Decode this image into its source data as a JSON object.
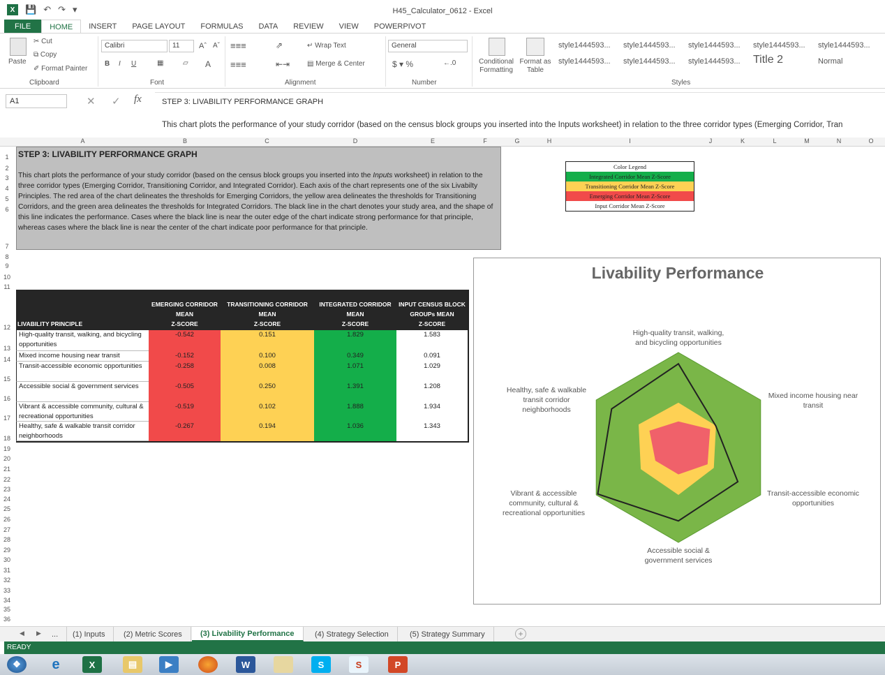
{
  "app": {
    "title": "H45_Calculator_0612 - Excel",
    "logo": "X",
    "ribbon_tabs": [
      "FILE",
      "HOME",
      "INSERT",
      "PAGE LAYOUT",
      "FORMULAS",
      "DATA",
      "REVIEW",
      "VIEW",
      "POWERPIVOT"
    ],
    "active_tab": "HOME"
  },
  "ribbon": {
    "clipboard": {
      "paste": "Paste",
      "cut": "Cut",
      "copy": "Copy",
      "format_painter": "Format Painter",
      "label": "Clipboard"
    },
    "font": {
      "name": "Calibri",
      "size": "11",
      "label": "Font",
      "bold": "B",
      "italic": "I",
      "underline": "U"
    },
    "alignment": {
      "wrap": "Wrap Text",
      "merge": "Merge & Center",
      "label": "Alignment"
    },
    "number": {
      "format": "General",
      "label": "Number"
    },
    "styles": {
      "conditional": "Conditional Formatting",
      "format_table": "Format as Table",
      "cells": [
        "style1444593...",
        "style1444593...",
        "style1444593...",
        "style1444593...",
        "style1444593...",
        "style1444593...",
        "style1444593...",
        "style1444593...",
        "Title 2",
        "Normal"
      ],
      "label": "Styles"
    }
  },
  "formula_bar": {
    "name_box": "A1",
    "fx": "fx",
    "line1": "STEP 3: LIVABILITY PERFORMANCE GRAPH",
    "line2": "This chart plots the performance of your study corridor (based on the census block groups you inserted into the Inputs worksheet) in relation to the three corridor types (Emerging Corridor, Tran"
  },
  "columns": [
    "A",
    "B",
    "C",
    "D",
    "E",
    "F",
    "G",
    "H",
    "I",
    "J",
    "K",
    "L",
    "M",
    "N",
    "O"
  ],
  "rows": [
    "1",
    "2",
    "3",
    "4",
    "5",
    "6",
    "7",
    "8",
    "9",
    "10",
    "11",
    "12",
    "13",
    "14",
    "15",
    "16",
    "17",
    "18",
    "19",
    "20",
    "21",
    "22",
    "23",
    "24",
    "25",
    "26",
    "27",
    "28",
    "29",
    "30",
    "31",
    "32",
    "33",
    "34",
    "35",
    "36"
  ],
  "sheet": {
    "step_title": "STEP 3: LIVABILITY PERFORMANCE GRAPH",
    "desc_1": "This chart plots the performance of your study corridor (based on the census block groups you inserted into the ",
    "desc_inputs": "Inputs",
    "desc_2": " worksheet) in relation to the three corridor types (Emerging Corridor, Transitioning Corridor, and Integrated Corridor).  Each axis of the chart represents one of the six Livabilty Principles.  The red area of the chart delineates the thresholds for Emerging Corridors, the yellow area delineates the thresholds for Transitioning Corridors, and the green area delineates the thresholds for Integrated Corridors.  The black line in the chart denotes your study area, and the shape of this line indicates the performance.  Cases where the black line is near the outer edge of the chart indicate strong performance for that principle, whereas cases where the black line is near the center of the chart indicate poor performance for that principle."
  },
  "legend": {
    "title": "Color Legend",
    "items": [
      {
        "label": "Integrated Corridor Mean Z-Score",
        "color": "#14ae4a"
      },
      {
        "label": "Transitioning Corridor Mean Z-Score",
        "color": "#fed154"
      },
      {
        "label": "Emerging Corridor Mean Z-Score",
        "color": "#f14a4a"
      },
      {
        "label": "Input Corridor Mean Z-Score",
        "color": "#ffffff"
      }
    ]
  },
  "table": {
    "header_principle": "LIVABILITY PRINCIPLE",
    "headers": [
      {
        "l1": "EMERGING CORRIDOR",
        "l2": "MEAN",
        "l3": "Z-SCORE"
      },
      {
        "l1": "TRANSITIONING CORRIDOR",
        "l2": "MEAN",
        "l3": "Z-SCORE"
      },
      {
        "l1": "INTEGRATED CORRIDOR",
        "l2": "MEAN",
        "l3": "Z-SCORE"
      },
      {
        "l1": "INPUT CENSUS BLOCK",
        "l2": "GROUPs MEAN",
        "l3": "Z-SCORE"
      }
    ],
    "rows": [
      {
        "principle": "High-quality transit, walking, and bicycling opportunities",
        "vals": [
          "-0.542",
          "0.151",
          "1.829",
          "1.583"
        ]
      },
      {
        "principle": "Mixed income housing near transit",
        "vals": [
          "-0.152",
          "0.100",
          "0.349",
          "0.091"
        ]
      },
      {
        "principle": "Transit-accessible economic opportunities",
        "vals": [
          "-0.258",
          "0.008",
          "1.071",
          "1.029"
        ]
      },
      {
        "principle": "Accessible social & government services",
        "vals": [
          "-0.505",
          "0.250",
          "1.391",
          "1.208"
        ]
      },
      {
        "principle": "Vibrant & accessible community, cultural & recreational opportunities",
        "vals": [
          "-0.519",
          "0.102",
          "1.888",
          "1.934"
        ]
      },
      {
        "principle": "Healthy, safe & walkable transit corridor neighborhoods",
        "vals": [
          "-0.267",
          "0.194",
          "1.036",
          "1.343"
        ]
      }
    ]
  },
  "chart_data": {
    "type": "radar",
    "title": "Livability Performance",
    "axes": [
      "High-quality transit, walking, and bicycling opportunities",
      "Mixed income housing near transit",
      "Transit-accessible economic opportunities",
      "Accessible social & government services",
      "Vibrant & accessible community, cultural & recreational opportunities",
      "Healthy, safe & walkable transit corridor neighborhoods"
    ],
    "axis_lines": [
      [
        "High-quality transit, walking,",
        "and bicycling opportunities"
      ],
      [
        "Mixed income housing near",
        "transit"
      ],
      [
        "Transit-accessible economic",
        "opportunities"
      ],
      [
        "Accessible social &",
        "government services"
      ],
      [
        "Vibrant & accessible",
        "community, cultural &",
        "recreational opportunities"
      ],
      [
        "Healthy, safe & walkable",
        "transit corridor",
        "neighborhoods"
      ]
    ],
    "range": [
      -1.5,
      2.0
    ],
    "series": [
      {
        "name": "Integrated Corridor Mean Z-Score",
        "values": [
          2.0,
          2.0,
          2.0,
          2.0,
          2.0,
          2.0
        ],
        "color": "#7ab648",
        "fill": true
      },
      {
        "name": "Transitioning Corridor Mean Z-Score",
        "values": [
          0.151,
          0.1,
          0.008,
          0.25,
          0.102,
          0.194
        ],
        "color": "#fed154",
        "fill": true
      },
      {
        "name": "Emerging Corridor Mean Z-Score",
        "values": [
          -0.542,
          -0.152,
          -0.258,
          -0.505,
          -0.519,
          -0.267
        ],
        "color": "#f0616a",
        "fill": true
      },
      {
        "name": "Input Corridor Mean Z-Score",
        "values": [
          1.583,
          0.091,
          1.029,
          1.208,
          1.934,
          1.343
        ],
        "color": "#222222",
        "fill": false
      }
    ]
  },
  "sheet_tabs": [
    "...",
    "(1) Inputs",
    "(2) Metric Scores",
    "(3) Livability Performance",
    "(4) Strategy Selection",
    "(5) Strategy Summary"
  ],
  "active_sheet": "(3) Livability Performance",
  "status": "READY"
}
